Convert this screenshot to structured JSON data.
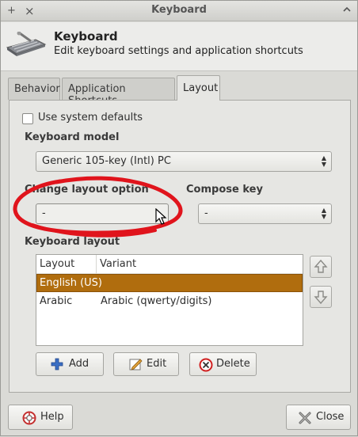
{
  "window": {
    "title": "Keyboard",
    "titlebar_left": "+",
    "titlebar_close": "×",
    "titlebar_right": "^"
  },
  "header": {
    "title": "Keyboard",
    "subtitle": "Edit keyboard settings and application shortcuts",
    "icon": "keyboard-icon"
  },
  "tabs": [
    {
      "label": "Behavior",
      "active": false
    },
    {
      "label": "Application Shortcuts",
      "active": false
    },
    {
      "label": "Layout",
      "active": true
    }
  ],
  "layout": {
    "use_system_defaults": {
      "label": "Use system defaults",
      "checked": false
    },
    "keyboard_model": {
      "label": "Keyboard model",
      "value": "Generic 105-key (Intl) PC"
    },
    "change_layout_option": {
      "label": "Change layout option",
      "value": "-"
    },
    "compose_key": {
      "label": "Compose key",
      "value": "-"
    },
    "keyboard_layout": {
      "label": "Keyboard layout",
      "columns": [
        "Layout",
        "Variant"
      ],
      "rows": [
        {
          "layout": "English (US)",
          "variant": "",
          "selected": true
        },
        {
          "layout": "Arabic",
          "variant": "Arabic (qwerty/digits)",
          "selected": false
        }
      ]
    },
    "buttons": {
      "add": "Add",
      "edit": "Edit",
      "delete": "Delete"
    }
  },
  "footer": {
    "help": "Help",
    "close": "Close"
  },
  "colors": {
    "selection": "#b06d0e",
    "annotation": "#e0141c",
    "add_icon": "#3b6fc4",
    "delete_icon": "#d02020"
  }
}
